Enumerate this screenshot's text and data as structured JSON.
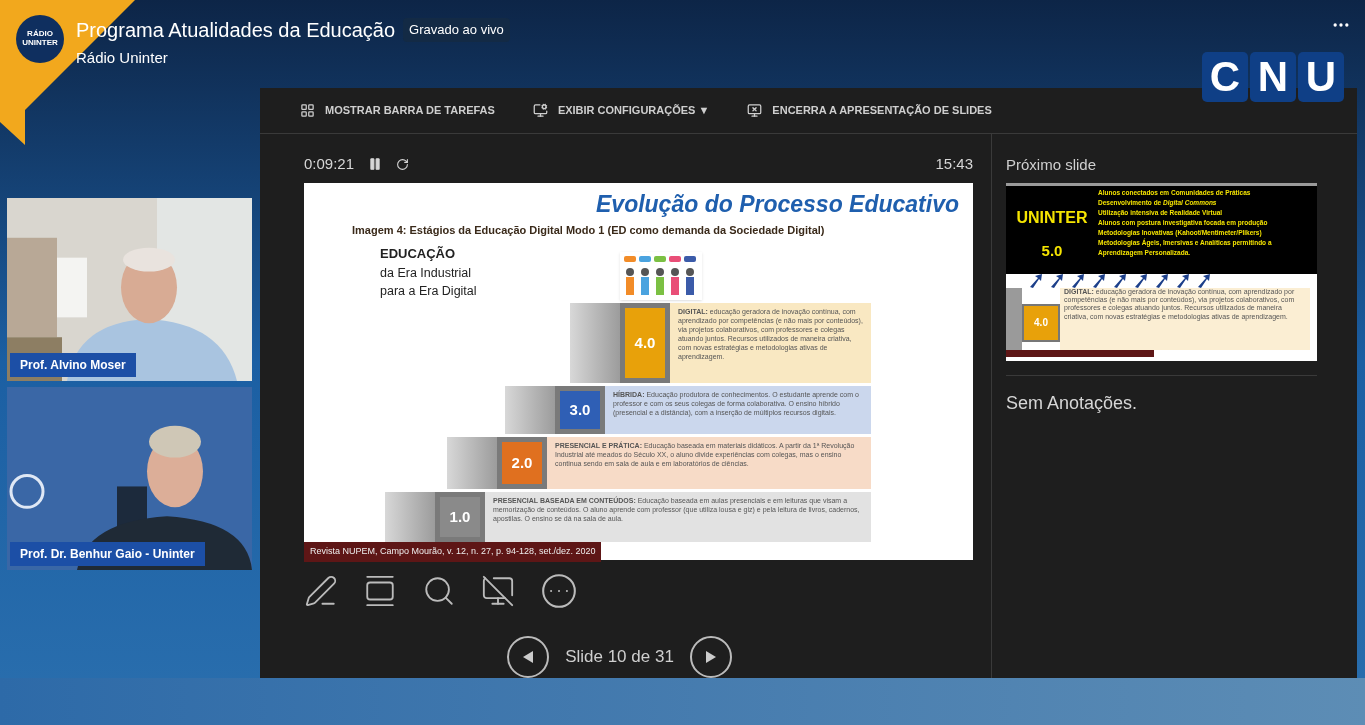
{
  "stream": {
    "avatar_lines": [
      "RÁDIO",
      "UNINTER"
    ],
    "title": "Programa Atualidades da Educação",
    "badge": "Gravado ao vivo",
    "channel": "Rádio Uninter"
  },
  "logo": {
    "letters": [
      "C",
      "N",
      "U"
    ]
  },
  "speakers": [
    {
      "name": "Prof. Alvino Moser",
      "kind": "room"
    },
    {
      "name": "Prof. Dr. Benhur Gaio - Uninter",
      "kind": "studio"
    }
  ],
  "presenter": {
    "toolbar": [
      {
        "label": "MOSTRAR BARRA DE TAREFAS",
        "kind": "taskbar"
      },
      {
        "label": "EXIBIR CONFIGURAÇÕES ▼",
        "kind": "settings"
      },
      {
        "label": "ENCERRA A APRESENTAÇÃO DE SLIDES",
        "kind": "end"
      }
    ],
    "elapsed": "0:09:21",
    "clock": "15:43",
    "slide": {
      "title": "Evolução do Processo Educativo",
      "subtitle": "Imagem 4: Estágios da Educação Digital Modo 1 (ED como demanda da Sociedade Digital)",
      "heading": "EDUCAÇÃO",
      "heading_lines": [
        "da Era Industrial",
        "para a Era Digital"
      ],
      "stages": [
        {
          "number": "4.0",
          "color": "#e8a10a",
          "text": "**DIGITAL:** educação geradora de inovação contínua, com aprendizado por competências (e não mais por conteúdos), via projetos colaborativos, com professores e colegas atuando juntos. Recursos utilizados de maneira criativa, com novas estratégias e metodologias ativas de aprendizagem."
        },
        {
          "number": "3.0",
          "color": "#2f5fb5",
          "text": "**HÍBRIDA:** Educação produtora de conhecimentos. O estudante aprende com o professor e com os seus colegas de forma colaborativa. O ensino híbrido (presencial e a distância), com a inserção de múltiplos recursos digitais."
        },
        {
          "number": "2.0",
          "color": "#e0701f",
          "text": "**PRESENCIAL E PRÁTICA:** Educação baseada em materiais didáticos. A partir da 1ª Revolução Industrial até meados do Século XX, o aluno divide experiências com colegas, mas o ensino continua sendo em sala de aula e em laboratórios de ciências."
        },
        {
          "number": "1.0",
          "color": "#8a8a8a",
          "text": "**PRESENCIAL BASEADA EM CONTEÚDOS:** Educação baseada em aulas presenciais e em leituras que visam a memorização de conteúdos. O aluno aprende com professor (que utiliza lousa e giz) e pela leitura de livros, cadernos, apostilas. O ensino se dá na sala de aula."
        }
      ],
      "citation": "Revista NUPEM, Campo Mourão, v. 12, n. 27, p. 94-128, set./dez. 2020"
    },
    "next_label": "Próximo slide",
    "next_slide": {
      "brand": "UNINTER",
      "version": "5.0",
      "items": [
        "Alunos conectados em Comunidades de Práticas",
        "Desenvolvimento de *Digital Commons*",
        "Utilização intensiva de Realidade Virtual",
        "Alunos com postura investigativa focada em produção",
        "Metodologias Inovativas (Kahoot/Mentimeter/Plikers)",
        "Metodologias Ágeis, Imersivas e Analíticas permitindo a Aprendizagem Personalizada."
      ],
      "stage": {
        "number": "4.0",
        "color": "#e8a10a",
        "text": "**DIGITAL:** educação geradora de inovação contínua, com aprendizado por competências (e não mais por conteúdos), via projetos colaborativos, com professores e colegas atuando juntos. Recursos utilizados de maneira criativa, com novas estratégias e metodologias ativas de aprendizagem."
      }
    },
    "notes": "Sem Anotações.",
    "counter": "Slide 10 de 31"
  }
}
